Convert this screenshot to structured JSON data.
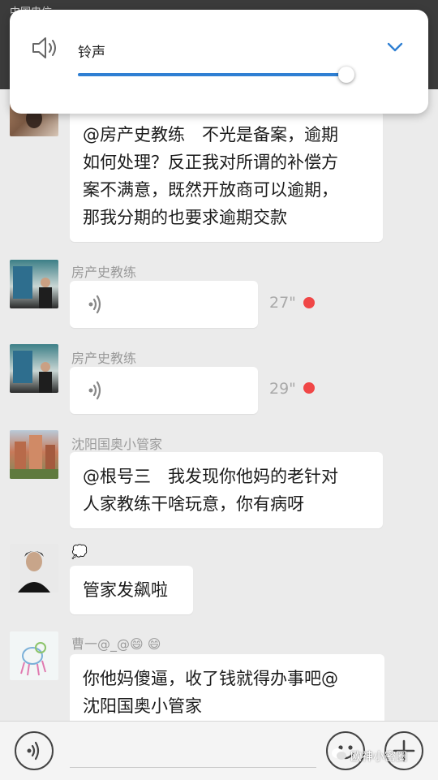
{
  "status_bar": {
    "carrier": "中国电信",
    "right": ""
  },
  "volume_panel": {
    "label": "铃声",
    "icon": "speaker-icon",
    "expand_icon": "chevron-down-icon",
    "level": 0.94,
    "accent": "#2f7fd3"
  },
  "messages": [
    {
      "type": "text",
      "sender": "",
      "avatar": "avatar-person-shirtless",
      "lines": [
        "@房产史教练　不光是备案，逾期",
        "如何处理？反正我对所谓的补偿方",
        "案不满意，既然开放商可以逾期，",
        "那我分期的也要求逾期交款"
      ]
    },
    {
      "type": "voice",
      "sender": "房产史教练",
      "avatar": "avatar-speaker-stage",
      "duration": "27\"",
      "unread": true
    },
    {
      "type": "voice",
      "sender": "房产史教练",
      "avatar": "avatar-speaker-stage",
      "duration": "29\"",
      "unread": true
    },
    {
      "type": "text",
      "sender": "沈阳国奥小管家",
      "avatar": "avatar-buildings",
      "lines": [
        "@根号三　我发现你他妈的老针对",
        "人家教练干啥玩意，你有病呀"
      ]
    },
    {
      "type": "text",
      "sender": "💭",
      "avatar": "avatar-man-portrait",
      "lines": [
        "管家发飙啦"
      ]
    },
    {
      "type": "text",
      "sender": "曹一@_@😄 😄",
      "avatar": "avatar-cartoon-dog",
      "lines": [
        "你他妈傻逼，收了钱就得办事吧@",
        "沈阳国奥小管家"
      ]
    }
  ],
  "bottom_bar": {
    "voice_button": "voice-toggle-icon",
    "emoji_button": "emoji-icon",
    "plus_button": "plus-icon"
  },
  "watermark": "欧神小密圈",
  "colors": {
    "unread": "#f04747",
    "background": "#ebebeb"
  }
}
